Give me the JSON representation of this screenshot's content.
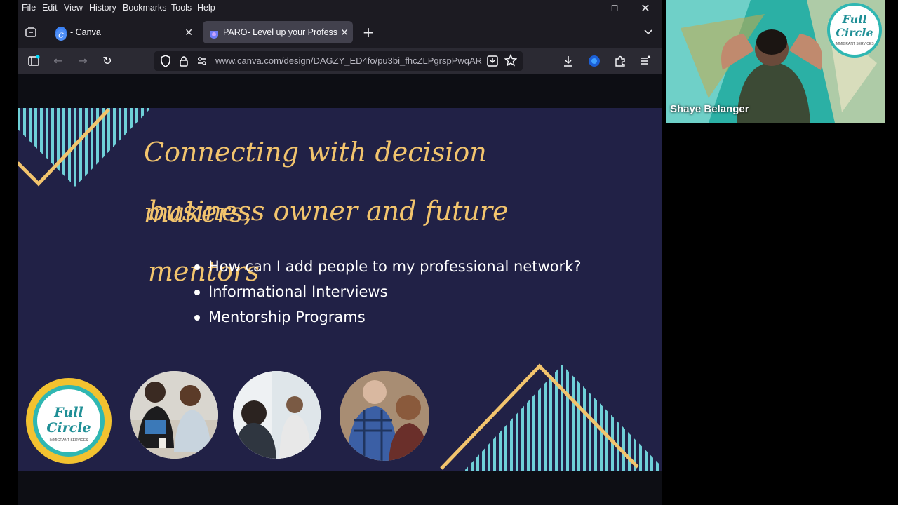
{
  "menubar": {
    "items": [
      "File",
      "Edit",
      "View",
      "History",
      "Bookmarks",
      "Tools",
      "Help"
    ]
  },
  "tabs": [
    {
      "label": "- Canva",
      "active": false
    },
    {
      "label": "PARO- Level up your Profession",
      "active": true
    }
  ],
  "navbar": {
    "url": "www.canva.com/design/DAGZY_ED4fo/pu3bi_fhcZLPgrspPwqAR"
  },
  "slide": {
    "title_line1": "Connecting with decision makers,",
    "title_line2": "business owner and future mentors",
    "bullets": [
      "How can I add people to my professional network?",
      "Informational Interviews",
      "Mentorship Programs"
    ],
    "logo": {
      "line1": "Full",
      "line2": "Circle",
      "sub": "IMMIGRANT SERVICES"
    }
  },
  "webcam": {
    "participant_name": "Shaye Belanger",
    "logo": {
      "line1": "Full",
      "line2": "Circle",
      "sub": "IMMIGRANT SERVICES"
    }
  },
  "colors": {
    "slide_bg": "#212146",
    "title_gold": "#f2c46d",
    "stripe_teal": "#6fd0d8",
    "browser_bg": "#1c1b22"
  },
  "icons": [
    "tab-overview-icon",
    "canva-favicon",
    "paro-favicon",
    "close-icon",
    "new-tab-icon",
    "tab-list-icon",
    "sidebar-icon",
    "back-icon",
    "forward-icon",
    "reload-icon",
    "shield-icon",
    "lock-icon",
    "permissions-icon",
    "reader-icon",
    "bookmark-star-icon",
    "download-icon",
    "extension-icon",
    "puzzle-icon",
    "menu-icon",
    "minimize-icon",
    "maximize-icon"
  ]
}
